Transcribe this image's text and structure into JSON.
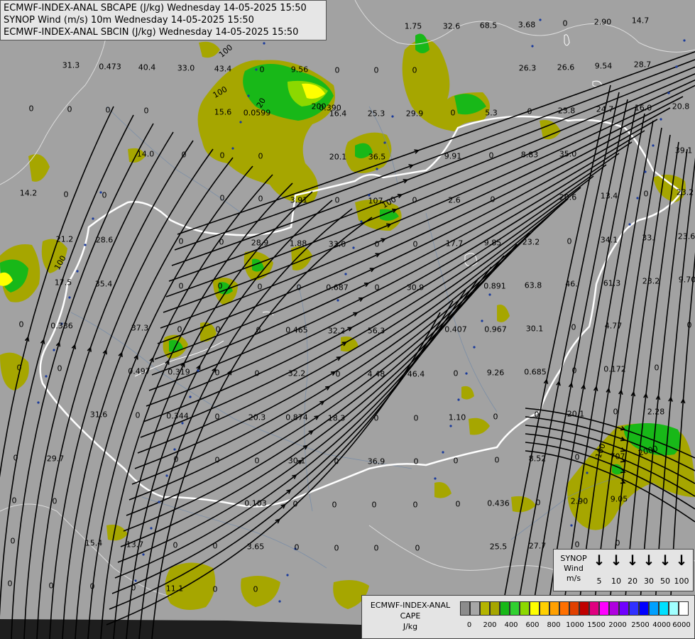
{
  "titles": [
    "ECMWF-INDEX-ANAL SBCAPE (J/kg) Wednesday 14-05-2025 15:50",
    "SYNOP Wind (m/s) 10m Wednesday 14-05-2025 15:50",
    "ECMWF-INDEX-ANAL SBCIN (J/kg) Wednesday 14-05-2025 15:50"
  ],
  "colors": {
    "background": "#a2a2a2",
    "cape_low": "#a6a600",
    "cape_mid": "#18b818",
    "cape_high": "#8cd800",
    "cape_peak": "#ffff00",
    "border": "#ffffff",
    "streamline": "#000000"
  },
  "values": [
    "31.3",
    "0.473",
    "40.4",
    "33.0",
    "43.4",
    "0",
    "9.56",
    "0",
    "0",
    "0",
    "1.75",
    "32.6",
    "68.5",
    "3.68",
    "0",
    "2.90",
    "14.7",
    "0",
    "0",
    "0",
    "0",
    "15.6",
    "0.0599",
    "0.390",
    "16.4",
    "25.3",
    "29.9",
    "0",
    "5.3",
    "0",
    "23.8",
    "24.7",
    "16.0",
    "20.8",
    "28.7",
    "9.92",
    "26.3",
    "26.6",
    "9.54",
    "14.0",
    "0",
    "0",
    "0",
    "20.1",
    "36.5",
    "9.91",
    "0",
    "8.83",
    "35.0",
    "39.1",
    "14.2",
    "0",
    "0",
    "0",
    "0",
    "3.91",
    "0",
    "107",
    "0",
    "2.6",
    "0",
    "20.6",
    "13.4",
    "0",
    "23.2",
    "21.2",
    "28.6",
    "0",
    "0",
    "28.9",
    "1.88",
    "33.0",
    "0",
    "0",
    "17.7",
    "9.85",
    "23.2",
    "0",
    "34.1",
    "33.",
    "23.6",
    "17.5",
    "35.4",
    "0",
    "0",
    "0",
    "0",
    "0.687",
    "0",
    "30.9",
    "0.891",
    "63.8",
    "46.",
    "61.3",
    "23.2",
    "9.70",
    "0",
    "0.336",
    "37.3",
    "0",
    "0",
    "0",
    "0.465",
    "32.2",
    "56.3",
    "0.407",
    "0.967",
    "30.1",
    "0",
    "4.77",
    "0",
    "0",
    "0",
    "0.497",
    "0.319",
    "0",
    "0",
    "32.2",
    "0",
    "4.48",
    "46.4",
    "0",
    "9.26",
    "0.685",
    "0",
    "0.172",
    "0",
    "31.6",
    "0",
    "0.344",
    "0",
    "20.3",
    "0.874",
    "18.3",
    "0",
    "0",
    "1.10",
    "0",
    "0",
    "20.1",
    "0",
    "2.28",
    "0",
    "29.7",
    "0",
    "0",
    "0",
    "30.1",
    "0",
    "36.9",
    "0",
    "0",
    "0",
    "8.52",
    "0",
    "707",
    "0",
    "0",
    "0.103",
    "0",
    "0",
    "0",
    "0",
    "0",
    "0.436",
    "0",
    "2.90",
    "9.05",
    "0",
    "15.4",
    "13.7",
    "0",
    "0",
    "3.65",
    "0",
    "0",
    "0",
    "0",
    "25.5",
    "27.7",
    "0",
    "0",
    "0",
    "0",
    "0",
    "0",
    "11.1",
    "0",
    "0"
  ],
  "contour_labels": [
    "100",
    "20",
    "100",
    "200",
    "100",
    "100",
    "2000",
    "100"
  ],
  "legend_wind": {
    "title_lines": [
      "SYNOP",
      "Wind",
      "m/s"
    ],
    "speeds": [
      "5",
      "10",
      "20",
      "30",
      "50",
      "100"
    ]
  },
  "legend_cape": {
    "title_lines": [
      "ECMWF-INDEX-ANAL",
      "CAPE",
      "J/kg"
    ],
    "ticks": [
      "0",
      "200",
      "400",
      "600",
      "800",
      "1000",
      "1500",
      "2000",
      "2500",
      "4000",
      "6000"
    ],
    "swatches": [
      "#8c8c8c",
      "#a6a6a6",
      "#b4b400",
      "#a6a600",
      "#18b818",
      "#30d030",
      "#8cd800",
      "#ffff00",
      "#ffd000",
      "#ffa000",
      "#ff7000",
      "#e04000",
      "#c00000",
      "#e00080",
      "#ff00ff",
      "#b000e0",
      "#7000ff",
      "#3030ff",
      "#0000ff",
      "#00a0ff",
      "#00e0ff",
      "#a0ffff",
      "#ffffff"
    ]
  }
}
